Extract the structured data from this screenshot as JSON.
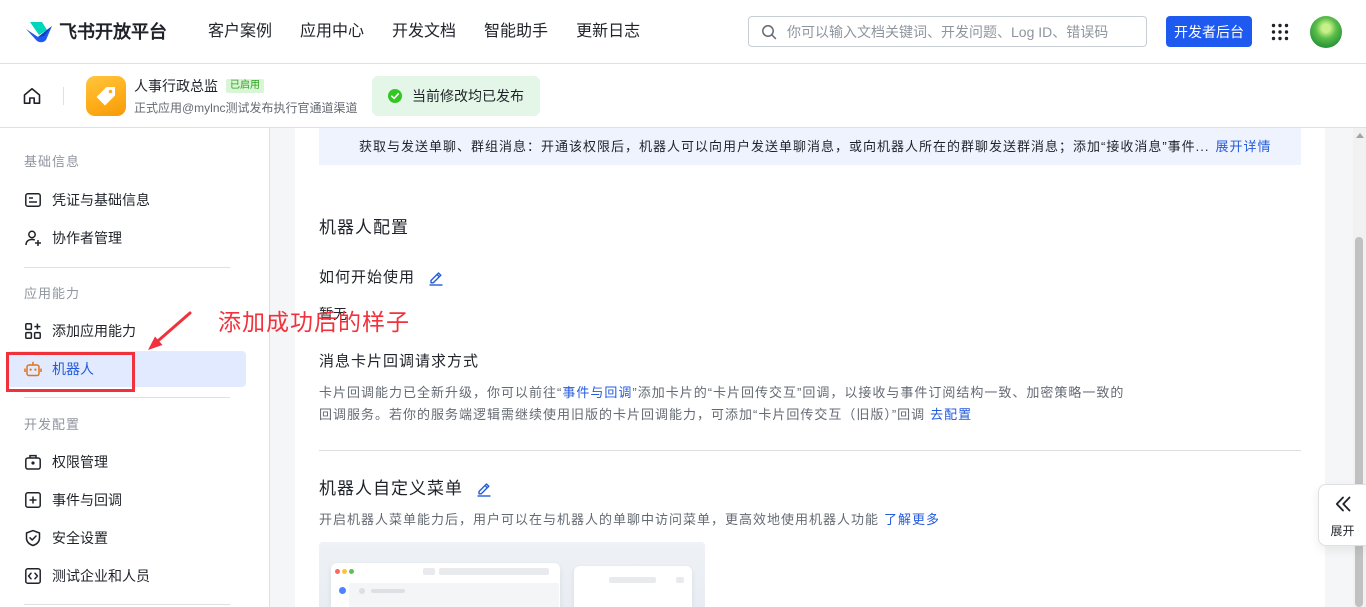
{
  "header": {
    "logo_text": "飞书开放平台",
    "nav": [
      "客户案例",
      "应用中心",
      "开发文档",
      "智能助手",
      "更新日志"
    ],
    "search_placeholder": "你可以输入文档关键词、开发问题、Log ID、错误码",
    "dev_console_label": "开发者后台",
    "icons": {
      "logo": "feishu-logo-icon",
      "search": "search-icon",
      "apps": "grid-icon",
      "avatar": "avatar"
    }
  },
  "app_bar": {
    "app_name": "人事行政总监",
    "status_badge": "已启用",
    "app_subtitle": "正式应用@mylnc测试发布执行官通道渠道",
    "publish_status": "当前修改均已发布",
    "icons": {
      "home": "home-icon",
      "app": "tag-icon",
      "status": "check-circle-icon"
    }
  },
  "sidebar": {
    "sections": [
      {
        "title": "基础信息",
        "items": [
          {
            "label": "凭证与基础信息",
            "icon": "credential-icon"
          },
          {
            "label": "协作者管理",
            "icon": "collaborator-icon"
          }
        ]
      },
      {
        "title": "应用能力",
        "items": [
          {
            "label": "添加应用能力",
            "icon": "add-capability-icon"
          },
          {
            "label": "机器人",
            "icon": "robot-icon",
            "active": true
          }
        ]
      },
      {
        "title": "开发配置",
        "items": [
          {
            "label": "权限管理",
            "icon": "permission-icon"
          },
          {
            "label": "事件与回调",
            "icon": "event-callback-icon"
          },
          {
            "label": "安全设置",
            "icon": "security-icon"
          },
          {
            "label": "测试企业和人员",
            "icon": "test-enterprise-icon"
          }
        ]
      }
    ]
  },
  "annotation": {
    "text": "添加成功后的样子"
  },
  "main": {
    "permission_notice": {
      "text": "获取与发送单聊、群组消息：开通该权限后，机器人可以向用户发送单聊消息，或向机器人所在的群聊发送群消息；添加“接收消息”事件...",
      "link": "展开详情"
    },
    "bot_config": {
      "title": "机器人配置",
      "how_to_start_label": "如何开始使用",
      "how_to_start_value": "暂无",
      "card_callback_title": "消息卡片回调请求方式",
      "card_callback_desc": {
        "text_1": "卡片回调能力已全新升级，你可以前往“",
        "link_1": "事件与回调",
        "text_2": "”添加卡片的“卡片回传交互”回调，以接收与事件订阅结构一致、加密策略一致的回调服务。若你的服务端逻辑需继续使用旧版的卡片回调能力，可添加“卡片回传交互（旧版）”回调",
        "link_2": "去配置"
      }
    },
    "bot_menu": {
      "title": "机器人自定义菜单",
      "desc": "开启机器人菜单能力后，用户可以在与机器人的单聊中访问菜单，更高效地使用机器人功能",
      "link": "了解更多"
    }
  },
  "float_panel": {
    "label": "展开",
    "icon": "double-chevron-left-icon"
  },
  "colors": {
    "accent": "#1f5af0",
    "link": "#245bdb",
    "annotation_red": "#f0323c",
    "success_green": "#34c724",
    "app_icon_orange": "#ffae1a",
    "active_item_bg": "#e1eaff"
  }
}
